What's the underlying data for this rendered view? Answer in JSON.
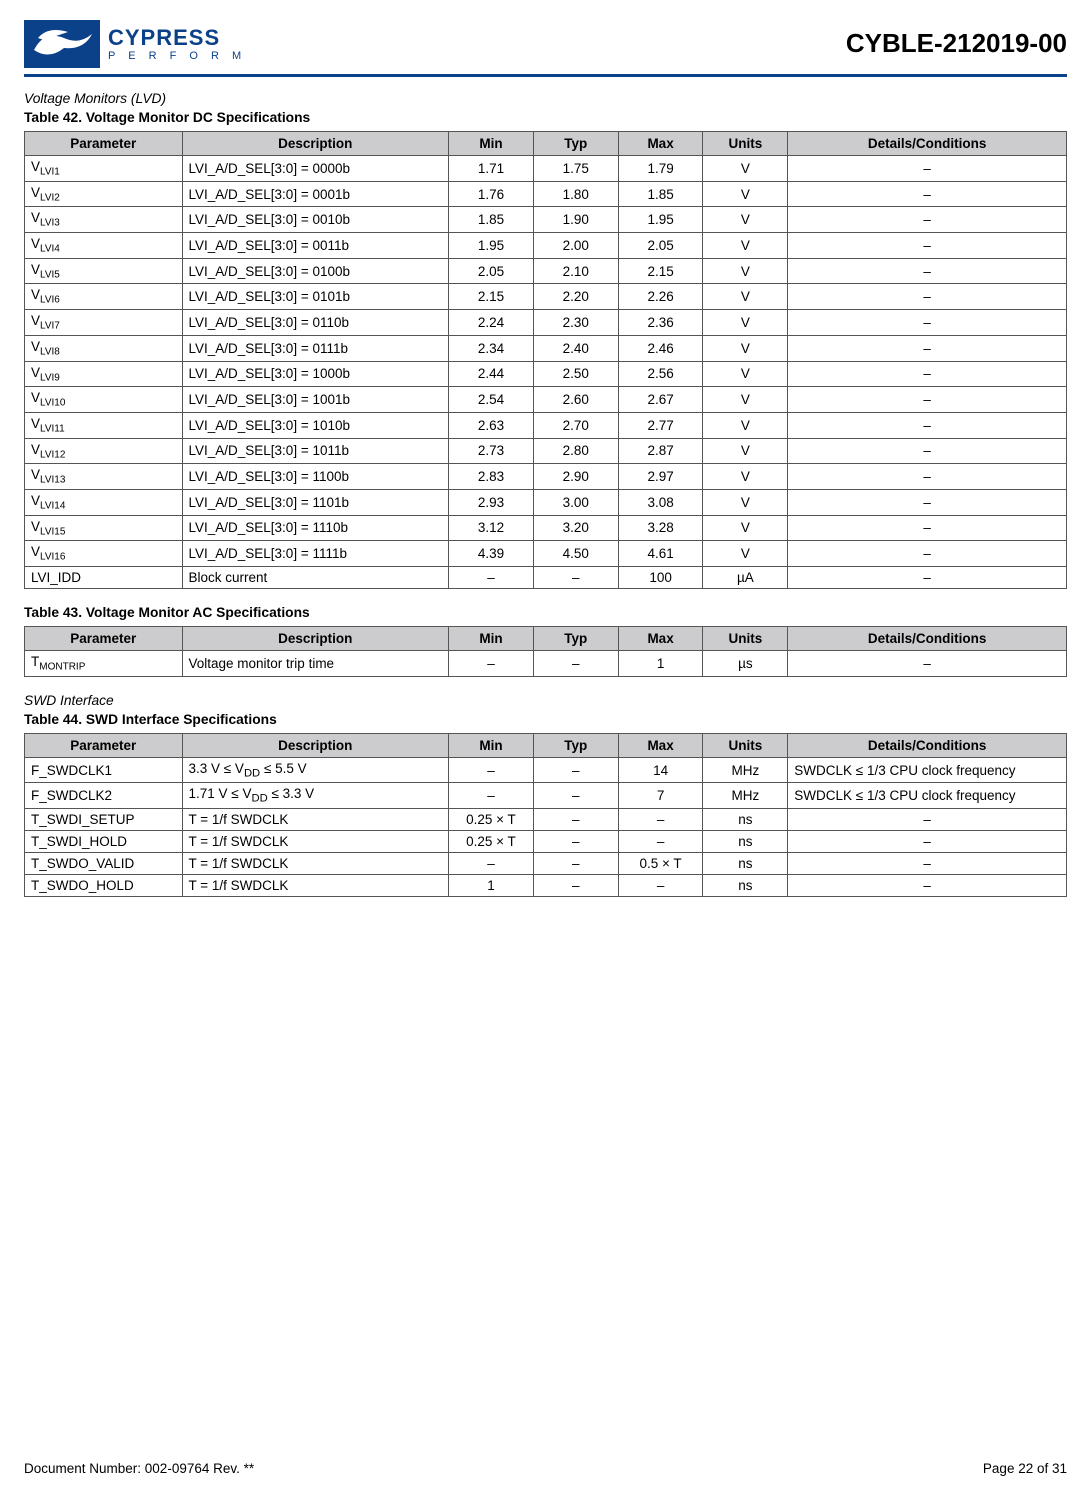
{
  "header": {
    "brand_name": "CYPRESS",
    "brand_tagline": "P E R F O R M",
    "part_number": "CYBLE-212019-00"
  },
  "section1_title": "Voltage Monitors (LVD)",
  "table42": {
    "caption": "Table 42.  Voltage Monitor DC Specifications",
    "headers": [
      "Parameter",
      "Description",
      "Min",
      "Typ",
      "Max",
      "Units",
      "Details/Conditions"
    ],
    "rows": [
      {
        "p_main": "V",
        "p_sub": "LVI1",
        "desc": "LVI_A/D_SEL[3:0] = 0000b",
        "min": "1.71",
        "typ": "1.75",
        "max": "1.79",
        "units": "V",
        "det": "–"
      },
      {
        "p_main": "V",
        "p_sub": "LVI2",
        "desc": "LVI_A/D_SEL[3:0] = 0001b",
        "min": "1.76",
        "typ": "1.80",
        "max": "1.85",
        "units": "V",
        "det": "–"
      },
      {
        "p_main": "V",
        "p_sub": "LVI3",
        "desc": "LVI_A/D_SEL[3:0] = 0010b",
        "min": "1.85",
        "typ": "1.90",
        "max": "1.95",
        "units": "V",
        "det": "–"
      },
      {
        "p_main": "V",
        "p_sub": "LVI4",
        "desc": "LVI_A/D_SEL[3:0] = 0011b",
        "min": "1.95",
        "typ": "2.00",
        "max": "2.05",
        "units": "V",
        "det": "–"
      },
      {
        "p_main": "V",
        "p_sub": "LVI5",
        "desc": "LVI_A/D_SEL[3:0] = 0100b",
        "min": "2.05",
        "typ": "2.10",
        "max": "2.15",
        "units": "V",
        "det": "–"
      },
      {
        "p_main": "V",
        "p_sub": "LVI6",
        "desc": "LVI_A/D_SEL[3:0] = 0101b",
        "min": "2.15",
        "typ": "2.20",
        "max": "2.26",
        "units": "V",
        "det": "–"
      },
      {
        "p_main": "V",
        "p_sub": "LVI7",
        "desc": "LVI_A/D_SEL[3:0] = 0110b",
        "min": "2.24",
        "typ": "2.30",
        "max": "2.36",
        "units": "V",
        "det": "–"
      },
      {
        "p_main": "V",
        "p_sub": "LVI8",
        "desc": "LVI_A/D_SEL[3:0] = 0111b",
        "min": "2.34",
        "typ": "2.40",
        "max": "2.46",
        "units": "V",
        "det": "–"
      },
      {
        "p_main": "V",
        "p_sub": "LVI9",
        "desc": "LVI_A/D_SEL[3:0] = 1000b",
        "min": "2.44",
        "typ": "2.50",
        "max": "2.56",
        "units": "V",
        "det": "–"
      },
      {
        "p_main": "V",
        "p_sub": "LVI10",
        "desc": "LVI_A/D_SEL[3:0] = 1001b",
        "min": "2.54",
        "typ": "2.60",
        "max": "2.67",
        "units": "V",
        "det": "–"
      },
      {
        "p_main": "V",
        "p_sub": "LVI11",
        "desc": "LVI_A/D_SEL[3:0] = 1010b",
        "min": "2.63",
        "typ": "2.70",
        "max": "2.77",
        "units": "V",
        "det": "–"
      },
      {
        "p_main": "V",
        "p_sub": "LVI12",
        "desc": "LVI_A/D_SEL[3:0] = 1011b",
        "min": "2.73",
        "typ": "2.80",
        "max": "2.87",
        "units": "V",
        "det": "–"
      },
      {
        "p_main": "V",
        "p_sub": "LVI13",
        "desc": "LVI_A/D_SEL[3:0] = 1100b",
        "min": "2.83",
        "typ": "2.90",
        "max": "2.97",
        "units": "V",
        "det": "–"
      },
      {
        "p_main": "V",
        "p_sub": "LVI14",
        "desc": "LVI_A/D_SEL[3:0] = 1101b",
        "min": "2.93",
        "typ": "3.00",
        "max": "3.08",
        "units": "V",
        "det": "–"
      },
      {
        "p_main": "V",
        "p_sub": "LVI15",
        "desc": "LVI_A/D_SEL[3:0] = 1110b",
        "min": "3.12",
        "typ": "3.20",
        "max": "3.28",
        "units": "V",
        "det": "–"
      },
      {
        "p_main": "V",
        "p_sub": "LVI16",
        "desc": "LVI_A/D_SEL[3:0] = 1111b",
        "min": "4.39",
        "typ": "4.50",
        "max": "4.61",
        "units": "V",
        "det": "–"
      },
      {
        "p_main": "LVI_IDD",
        "p_sub": "",
        "desc": "Block current",
        "min": "–",
        "typ": "–",
        "max": "100",
        "units": "µA",
        "det": "–"
      }
    ]
  },
  "table43": {
    "caption": "Table 43.  Voltage Monitor AC Specifications",
    "headers": [
      "Parameter",
      "Description",
      "Min",
      "Typ",
      "Max",
      "Units",
      "Details/Conditions"
    ],
    "rows": [
      {
        "p_main": "T",
        "p_sub": "MONTRIP",
        "desc": "Voltage monitor trip time",
        "min": "–",
        "typ": "–",
        "max": "1",
        "units": "µs",
        "det": "–"
      }
    ]
  },
  "section2_title": "SWD Interface",
  "table44": {
    "caption": "Table 44.  SWD Interface Specifications",
    "headers": [
      "Parameter",
      "Description",
      "Min",
      "Typ",
      "Max",
      "Units",
      "Details/Conditions"
    ],
    "rows": [
      {
        "param": "F_SWDCLK1",
        "desc_html": "3.3 V ≤ V<sub>DD</sub> ≤ 5.5 V",
        "min": "–",
        "typ": "–",
        "max": "14",
        "units": "MHz",
        "det": "SWDCLK ≤ 1/3 CPU clock frequency",
        "det_align": "l"
      },
      {
        "param": "F_SWDCLK2",
        "desc_html": "1.71 V ≤ V<sub>DD</sub> ≤ 3.3 V",
        "min": "–",
        "typ": "–",
        "max": "7",
        "units": "MHz",
        "det": "SWDCLK ≤ 1/3 CPU clock frequency",
        "det_align": "l"
      },
      {
        "param": "T_SWDI_SETUP",
        "desc_html": "T = 1/f SWDCLK",
        "min": "0.25 × T",
        "typ": "–",
        "max": "–",
        "units": "ns",
        "det": "–",
        "det_align": "c"
      },
      {
        "param": "T_SWDI_HOLD",
        "desc_html": "T = 1/f SWDCLK",
        "min": "0.25 × T",
        "typ": "–",
        "max": "–",
        "units": "ns",
        "det": "–",
        "det_align": "c"
      },
      {
        "param": "T_SWDO_VALID",
        "desc_html": "T = 1/f SWDCLK",
        "min": "–",
        "typ": "–",
        "max": "0.5 × T",
        "units": "ns",
        "det": "–",
        "det_align": "c"
      },
      {
        "param": "T_SWDO_HOLD",
        "desc_html": "T = 1/f SWDCLK",
        "min": "1",
        "typ": "–",
        "max": "–",
        "units": "ns",
        "det": "–",
        "det_align": "c"
      }
    ]
  },
  "footer": {
    "left": "Document Number: 002-09764 Rev. **",
    "right": "Page 22 of 31"
  }
}
